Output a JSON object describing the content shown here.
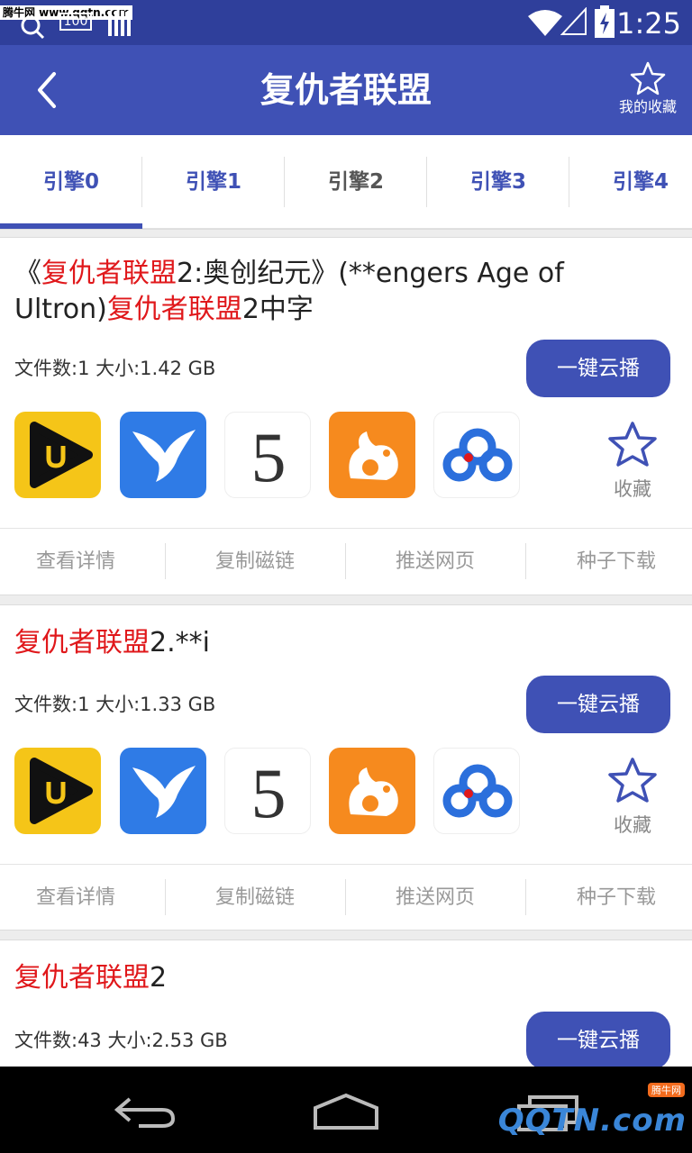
{
  "status_bar": {
    "watermark": "腾牛网 www.qqtn.com",
    "badge_text": "100",
    "time": "1:25",
    "icons": [
      "search-icon",
      "wifi-icon",
      "signal-icon",
      "battery-charging-icon"
    ]
  },
  "app_bar": {
    "title": "复仇者联盟",
    "favorites_label": "我的收藏",
    "back_icon": "back-arrow-icon",
    "favorites_icon": "star-outline-icon"
  },
  "tabs": [
    {
      "label": "引擎0",
      "selected": true
    },
    {
      "label": "引擎1",
      "selected": false
    },
    {
      "label": "引擎2",
      "selected": false
    },
    {
      "label": "引擎3",
      "selected": false
    },
    {
      "label": "引擎4",
      "selected": false
    }
  ],
  "results": [
    {
      "title_parts": [
        {
          "text": "《",
          "highlight": false
        },
        {
          "text": "复仇者联盟",
          "highlight": true
        },
        {
          "text": "2:奥创纪元》(**engers Age of Ultron)",
          "highlight": false
        },
        {
          "text": "复仇者联盟",
          "highlight": true
        },
        {
          "text": "2中字",
          "highlight": false
        }
      ],
      "meta": "文件数:1 大小:1.42 GB",
      "play_label": "一键云播",
      "collect_label": "收藏",
      "actions": [
        "查看详情",
        "复制磁链",
        "推送网页",
        "种子下载"
      ]
    },
    {
      "title_parts": [
        {
          "text": "复仇者联盟",
          "highlight": true
        },
        {
          "text": "2.**i",
          "highlight": false
        }
      ],
      "meta": "文件数:1 大小:1.33 GB",
      "play_label": "一键云播",
      "collect_label": "收藏",
      "actions": [
        "查看详情",
        "复制磁链",
        "推送网页",
        "种子下载"
      ]
    },
    {
      "title_parts": [
        {
          "text": "复仇者联盟",
          "highlight": true
        },
        {
          "text": "2",
          "highlight": false
        }
      ],
      "meta": "文件数:43 大小:2.53 GB",
      "play_label": "一键云播"
    }
  ],
  "player_apps": [
    "youku-player-icon",
    "xunlei-bird-icon",
    "5-player-icon",
    "uc-browser-icon",
    "baidu-cloud-icon"
  ],
  "nav_bar": {
    "icons": [
      "back-nav-icon",
      "home-nav-icon",
      "recents-nav-icon"
    ],
    "watermark": "QQTN.com",
    "watermark_small": "腾牛网"
  },
  "colors": {
    "primary": "#3f51b5",
    "status_bar": "#2f3f9b",
    "highlight": "#e0181b"
  }
}
